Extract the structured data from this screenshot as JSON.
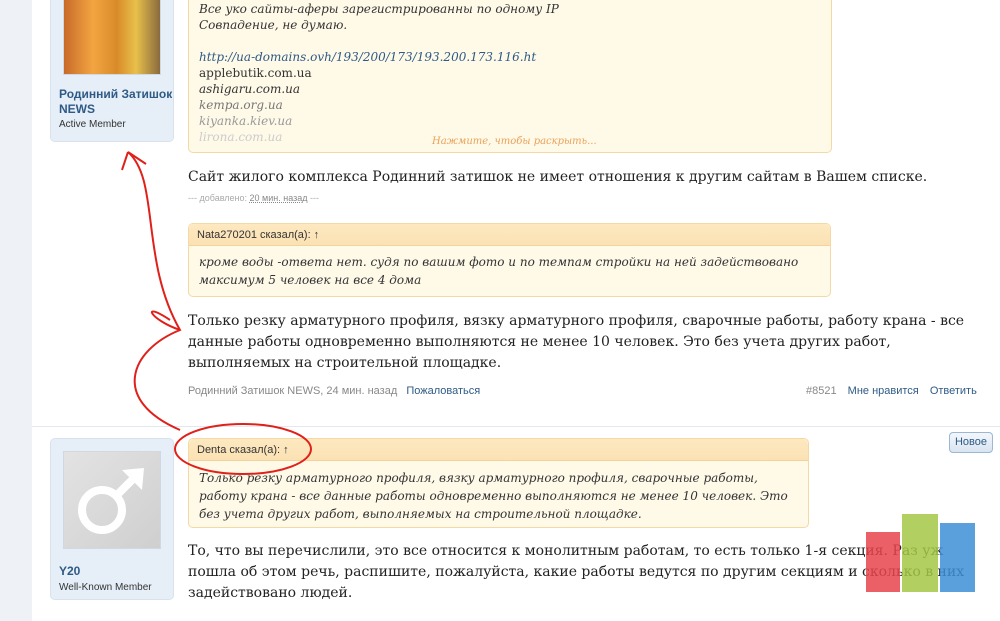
{
  "post1": {
    "user_name": "Родинний Затишок NEWS",
    "user_title": "Active Member",
    "quote_lines": [
      "Все уко сайты-аферы зарегистрированны по одному IP",
      "Совпадение, не думаю."
    ],
    "quote_link": "http://ua-domains.ovh/193/200/173/193.200.173.116.ht",
    "domains": [
      "applebutik.com.ua",
      "ashigaru.com.ua",
      "kempa.org.ua",
      "kiyanka.kiev.ua",
      "lirona.com.ua"
    ],
    "expand_label": "Нажмите, чтобы раскрыть...",
    "text1": "Сайт жилого комплекса Родинний затишок не имеет отношения к другим сайтам в Вашем списке.",
    "added_prefix": "--- добавлено:",
    "added_time": "20 мин. назад",
    "added_suffix": "---",
    "quote2_head": "Nata270201 сказал(а): ↑",
    "quote2_text": "кроме воды -ответа нет. судя по вашим фото и по темпам стройки на ней задействовано максимум 5 человек на все 4 дома",
    "text2": "Только резку арматурного профиля, вязку арматурного профиля, сварочные работы, работу крана - все данные работы одновременно выполняются не менее 10 человек. Это без учета других работ, выполняемых на строительной площадке.",
    "meta_author_time": "Родинний Затишок NEWS, 24 мин. назад",
    "report": "Пожаловаться",
    "post_number": "#8521",
    "dislike": "Мне нравится",
    "reply": "Ответить"
  },
  "post2": {
    "user_name": "Y20",
    "user_title": "Well-Known Member",
    "new_button": "Новое",
    "quote_head": "Denta сказал(а): ↑",
    "quote_text": "Только резку арматурного профиля, вязку арматурного профиля, сварочные работы, работу крана - все данные работы одновременно выполняются не менее 10 человек. Это без учета других работ, выполняемых на строительной площадке.",
    "text": "То, что вы перечислили, это все относится к монолитным работам, то есть только 1-я секция. Раз уж пошла об этом речь, распишите, пожалуйста, какие работы ведутся по другим секциям и сколько в них задействовано людей."
  },
  "colors": {
    "annotation": "#e0201a",
    "accent": "#2e5a85"
  }
}
